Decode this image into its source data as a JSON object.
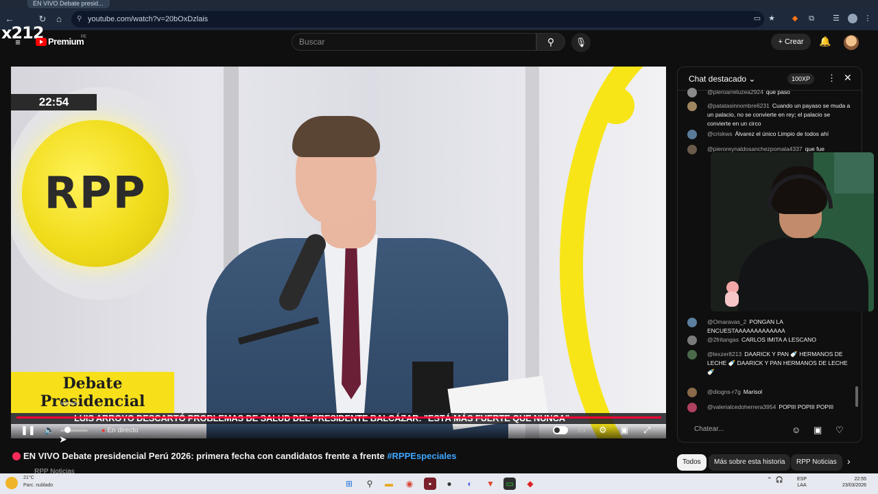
{
  "browser": {
    "url": "youtube.com/watch?v=20bOxDzlais",
    "tab_text": "EN VIVO Debate presid..."
  },
  "overlay": {
    "streamer_tag": "x212"
  },
  "youtube": {
    "logo_label": "Premium",
    "logo_region": "PE",
    "search_placeholder": "Buscar",
    "create_label": "+ Crear"
  },
  "video": {
    "clock": "22:54",
    "brand": "RPP",
    "program_line1": "Debate",
    "program_line2": "Presidencial",
    "ticker": "LUIS ARROYO DESCARTÓ PROBLEMAS DE SALUD DEL PRESIDENTE BALCÁZAR: \"ESTÁ MÁS FUERTE QUE NUNCA\"",
    "live_label": "En directo",
    "volume_tooltip": "Volumen",
    "volume_level": 0.25
  },
  "chat": {
    "title": "Chat destacado",
    "xp_badge": "100XP",
    "input_placeholder": "Chatear...",
    "messages": [
      {
        "author": "@pieroarreluzea2924",
        "text": "que paso",
        "color": "#8a8a8a"
      },
      {
        "author": "@patatasinnombre6231",
        "text": "Cuando un payaso se muda a un palacio, no se convierte en rey; el palacio se convierte en un circo",
        "color": "#a08660"
      },
      {
        "author": "@criskws",
        "text": "Álvarez el único Limpio de todos ahí",
        "color": "#5a7a9a"
      },
      {
        "author": "@pieroreynaldosanchezpomala4337",
        "text": "que fue",
        "color": "#6a5a4a"
      },
      {
        "author": "@Omaravas_2",
        "text": "PONGAN LA ENCUESTAAAAAAAAAAAAA",
        "color": "#5c7fa0"
      },
      {
        "author": "@2fritangas",
        "text": "CARLOS IMITA A LESCANO",
        "color": "#7a7a7a"
      },
      {
        "author": "@lexzer8213",
        "text": "DAARICK Y PAN 🍼 HERMANOS DE LECHE 🍼 DAARICK Y PAN HERMANOS DE LECHE 🍼",
        "color": "#4a6a4a"
      },
      {
        "author": "@diogns-r7g",
        "text": "Marisol",
        "color": "#8a6a4a"
      },
      {
        "author": "@valerialcedoherrera3954",
        "text": "POPIII POPIII POPIII",
        "color": "#b04060"
      }
    ]
  },
  "below_video": {
    "title_live": "EN VIVO Debate presidencial Perú 2026: primera fecha con candidatos frente a frente",
    "title_tag": "#RPPEspeciales",
    "channel": "RPP Noticias",
    "chips": [
      "Todos",
      "Más sobre esta historia",
      "RPP Noticias"
    ]
  },
  "taskbar": {
    "weather_temp": "21°C",
    "weather_cond": "Parc. nublado",
    "lang_top": "ESP",
    "lang_bottom": "LAA",
    "time": "22:55",
    "date": "23/03/2026"
  }
}
